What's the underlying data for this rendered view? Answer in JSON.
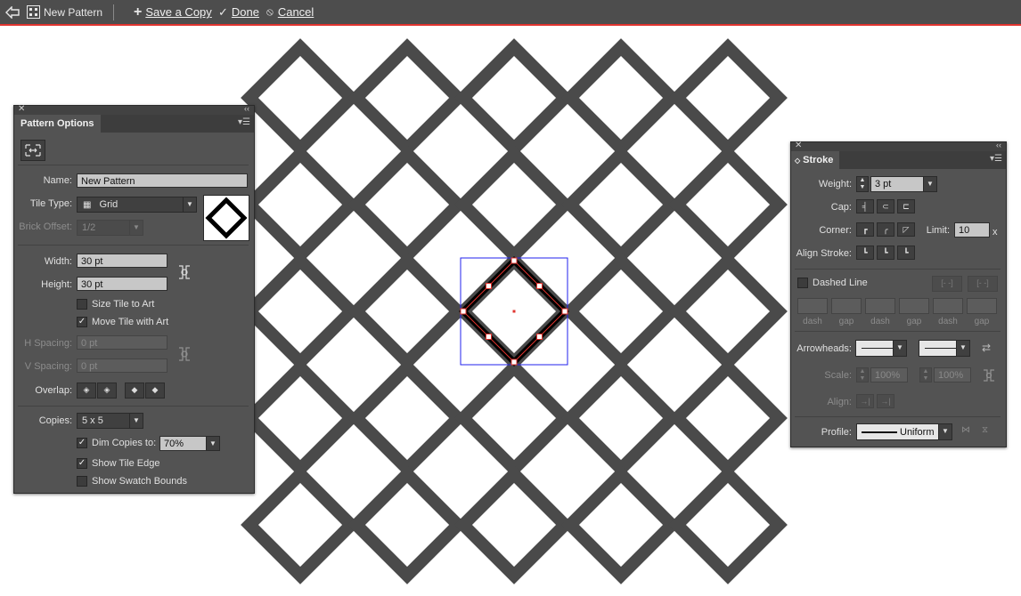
{
  "colors": {
    "accent_line": "#e0342f",
    "pattern_stroke": "#4a4a4a",
    "selection": "#2222ee"
  },
  "topbar": {
    "back_icon": "back-arrow-icon",
    "pattern_icon": "pattern-icon",
    "pattern_name": "New Pattern",
    "save_copy": "Save a Copy",
    "done": "Done",
    "cancel": "Cancel"
  },
  "pattern_options": {
    "tab": "Pattern Options",
    "name_label": "Name:",
    "name_value": "New Pattern",
    "tile_type_label": "Tile Type:",
    "tile_type_value": "Grid",
    "brick_offset_label": "Brick Offset:",
    "brick_offset_value": "1/2",
    "width_label": "Width:",
    "width_value": "30 pt",
    "height_label": "Height:",
    "height_value": "30 pt",
    "size_tile": "Size Tile to Art",
    "move_tile": "Move Tile with Art",
    "h_spacing_label": "H Spacing:",
    "h_spacing_value": "0 pt",
    "v_spacing_label": "V Spacing:",
    "v_spacing_value": "0 pt",
    "overlap_label": "Overlap:",
    "copies_label": "Copies:",
    "copies_value": "5 x 5",
    "dim_copies": "Dim Copies to:",
    "dim_value": "70%",
    "show_tile_edge": "Show Tile Edge",
    "show_swatch_bounds": "Show Swatch Bounds",
    "checks": {
      "size_tile": false,
      "move_tile": true,
      "dim_copies": true,
      "show_tile_edge": true,
      "show_swatch_bounds": false
    }
  },
  "stroke": {
    "tab": "Stroke",
    "weight_label": "Weight:",
    "weight_value": "3 pt",
    "cap_label": "Cap:",
    "corner_label": "Corner:",
    "limit_label": "Limit:",
    "limit_value": "10",
    "limit_x": "x",
    "align_label": "Align Stroke:",
    "dashed": "Dashed Line",
    "dash_labels": [
      "dash",
      "gap",
      "dash",
      "gap",
      "dash",
      "gap"
    ],
    "arrowheads_label": "Arrowheads:",
    "scale_label": "Scale:",
    "scale1": "100%",
    "scale2": "100%",
    "align2_label": "Align:",
    "profile_label": "Profile:",
    "profile_value": "Uniform"
  }
}
